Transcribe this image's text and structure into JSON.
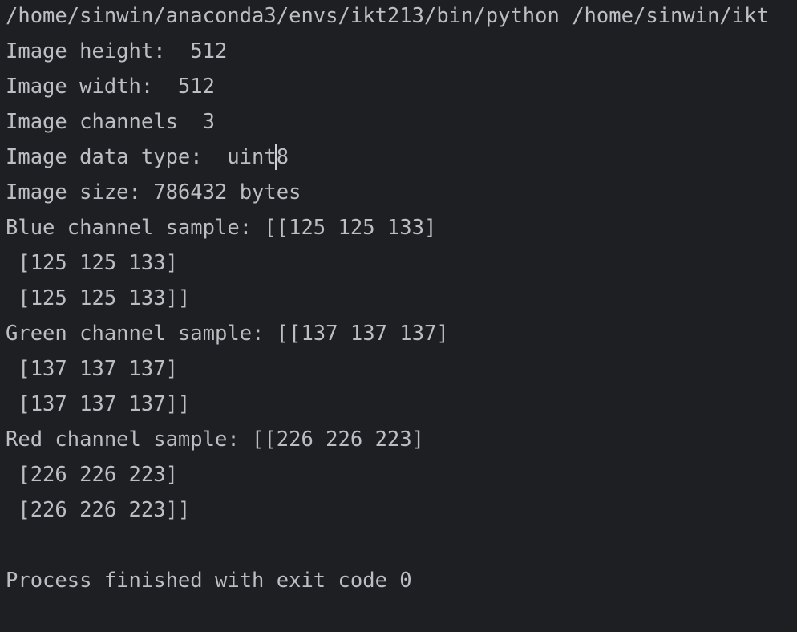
{
  "console": {
    "command": "/home/sinwin/anaconda3/envs/ikt213/bin/python /home/sinwin/ikt",
    "lines": [
      "Image height:  512",
      "Image width:  512",
      "Image channels  3",
      "Image data type:  uint8",
      "Image size: 786432 bytes",
      "Blue channel sample: [[125 125 133]",
      " [125 125 133]",
      " [125 125 133]]",
      "Green channel sample: [[137 137 137]",
      " [137 137 137]",
      " [137 137 137]]",
      "Red channel sample: [[226 226 223]",
      " [226 226 223]",
      " [226 226 223]]",
      "",
      "Process finished with exit code 0"
    ],
    "dtype_before_caret": "uint",
    "dtype_after_caret": "8"
  }
}
